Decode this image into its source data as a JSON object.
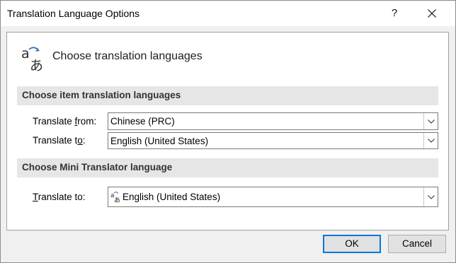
{
  "window": {
    "title": "Translation Language Options",
    "help_label": "?",
    "accent_color": "#0078d7"
  },
  "header": {
    "icon": "translate-icon",
    "text": "Choose translation languages"
  },
  "item_section": {
    "title": "Choose item translation languages",
    "from_label_pre": "Translate ",
    "from_label_key": "f",
    "from_label_post": "rom:",
    "from_value": "Chinese (PRC)",
    "to_label_pre": "Translate t",
    "to_label_key": "o",
    "to_label_post": ":",
    "to_value": "English (United States)"
  },
  "mini_section": {
    "title": "Choose Mini Translator language",
    "to_label_key": "T",
    "to_label_post": "ranslate to:",
    "to_value": "English (United States)",
    "value_icon": "translate-icon"
  },
  "buttons": {
    "ok": "OK",
    "cancel": "Cancel"
  }
}
